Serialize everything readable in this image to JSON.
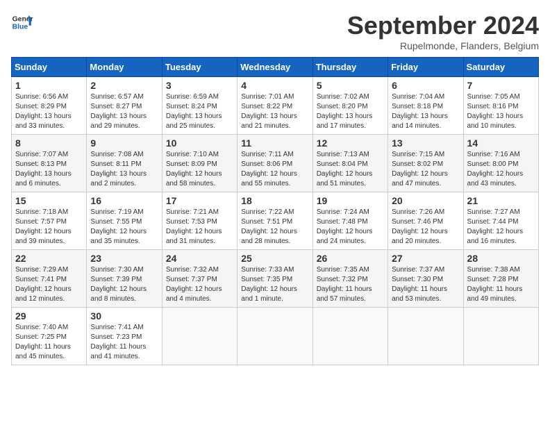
{
  "header": {
    "logo_general": "General",
    "logo_blue": "Blue",
    "title": "September 2024",
    "subtitle": "Rupelmonde, Flanders, Belgium"
  },
  "days_of_week": [
    "Sunday",
    "Monday",
    "Tuesday",
    "Wednesday",
    "Thursday",
    "Friday",
    "Saturday"
  ],
  "weeks": [
    [
      {
        "day": "1",
        "info": "Sunrise: 6:56 AM\nSunset: 8:29 PM\nDaylight: 13 hours\nand 33 minutes."
      },
      {
        "day": "2",
        "info": "Sunrise: 6:57 AM\nSunset: 8:27 PM\nDaylight: 13 hours\nand 29 minutes."
      },
      {
        "day": "3",
        "info": "Sunrise: 6:59 AM\nSunset: 8:24 PM\nDaylight: 13 hours\nand 25 minutes."
      },
      {
        "day": "4",
        "info": "Sunrise: 7:01 AM\nSunset: 8:22 PM\nDaylight: 13 hours\nand 21 minutes."
      },
      {
        "day": "5",
        "info": "Sunrise: 7:02 AM\nSunset: 8:20 PM\nDaylight: 13 hours\nand 17 minutes."
      },
      {
        "day": "6",
        "info": "Sunrise: 7:04 AM\nSunset: 8:18 PM\nDaylight: 13 hours\nand 14 minutes."
      },
      {
        "day": "7",
        "info": "Sunrise: 7:05 AM\nSunset: 8:16 PM\nDaylight: 13 hours\nand 10 minutes."
      }
    ],
    [
      {
        "day": "8",
        "info": "Sunrise: 7:07 AM\nSunset: 8:13 PM\nDaylight: 13 hours\nand 6 minutes."
      },
      {
        "day": "9",
        "info": "Sunrise: 7:08 AM\nSunset: 8:11 PM\nDaylight: 13 hours\nand 2 minutes."
      },
      {
        "day": "10",
        "info": "Sunrise: 7:10 AM\nSunset: 8:09 PM\nDaylight: 12 hours\nand 58 minutes."
      },
      {
        "day": "11",
        "info": "Sunrise: 7:11 AM\nSunset: 8:06 PM\nDaylight: 12 hours\nand 55 minutes."
      },
      {
        "day": "12",
        "info": "Sunrise: 7:13 AM\nSunset: 8:04 PM\nDaylight: 12 hours\nand 51 minutes."
      },
      {
        "day": "13",
        "info": "Sunrise: 7:15 AM\nSunset: 8:02 PM\nDaylight: 12 hours\nand 47 minutes."
      },
      {
        "day": "14",
        "info": "Sunrise: 7:16 AM\nSunset: 8:00 PM\nDaylight: 12 hours\nand 43 minutes."
      }
    ],
    [
      {
        "day": "15",
        "info": "Sunrise: 7:18 AM\nSunset: 7:57 PM\nDaylight: 12 hours\nand 39 minutes."
      },
      {
        "day": "16",
        "info": "Sunrise: 7:19 AM\nSunset: 7:55 PM\nDaylight: 12 hours\nand 35 minutes."
      },
      {
        "day": "17",
        "info": "Sunrise: 7:21 AM\nSunset: 7:53 PM\nDaylight: 12 hours\nand 31 minutes."
      },
      {
        "day": "18",
        "info": "Sunrise: 7:22 AM\nSunset: 7:51 PM\nDaylight: 12 hours\nand 28 minutes."
      },
      {
        "day": "19",
        "info": "Sunrise: 7:24 AM\nSunset: 7:48 PM\nDaylight: 12 hours\nand 24 minutes."
      },
      {
        "day": "20",
        "info": "Sunrise: 7:26 AM\nSunset: 7:46 PM\nDaylight: 12 hours\nand 20 minutes."
      },
      {
        "day": "21",
        "info": "Sunrise: 7:27 AM\nSunset: 7:44 PM\nDaylight: 12 hours\nand 16 minutes."
      }
    ],
    [
      {
        "day": "22",
        "info": "Sunrise: 7:29 AM\nSunset: 7:41 PM\nDaylight: 12 hours\nand 12 minutes."
      },
      {
        "day": "23",
        "info": "Sunrise: 7:30 AM\nSunset: 7:39 PM\nDaylight: 12 hours\nand 8 minutes."
      },
      {
        "day": "24",
        "info": "Sunrise: 7:32 AM\nSunset: 7:37 PM\nDaylight: 12 hours\nand 4 minutes."
      },
      {
        "day": "25",
        "info": "Sunrise: 7:33 AM\nSunset: 7:35 PM\nDaylight: 12 hours\nand 1 minute."
      },
      {
        "day": "26",
        "info": "Sunrise: 7:35 AM\nSunset: 7:32 PM\nDaylight: 11 hours\nand 57 minutes."
      },
      {
        "day": "27",
        "info": "Sunrise: 7:37 AM\nSunset: 7:30 PM\nDaylight: 11 hours\nand 53 minutes."
      },
      {
        "day": "28",
        "info": "Sunrise: 7:38 AM\nSunset: 7:28 PM\nDaylight: 11 hours\nand 49 minutes."
      }
    ],
    [
      {
        "day": "29",
        "info": "Sunrise: 7:40 AM\nSunset: 7:25 PM\nDaylight: 11 hours\nand 45 minutes."
      },
      {
        "day": "30",
        "info": "Sunrise: 7:41 AM\nSunset: 7:23 PM\nDaylight: 11 hours\nand 41 minutes."
      },
      {
        "day": "",
        "info": ""
      },
      {
        "day": "",
        "info": ""
      },
      {
        "day": "",
        "info": ""
      },
      {
        "day": "",
        "info": ""
      },
      {
        "day": "",
        "info": ""
      }
    ]
  ]
}
